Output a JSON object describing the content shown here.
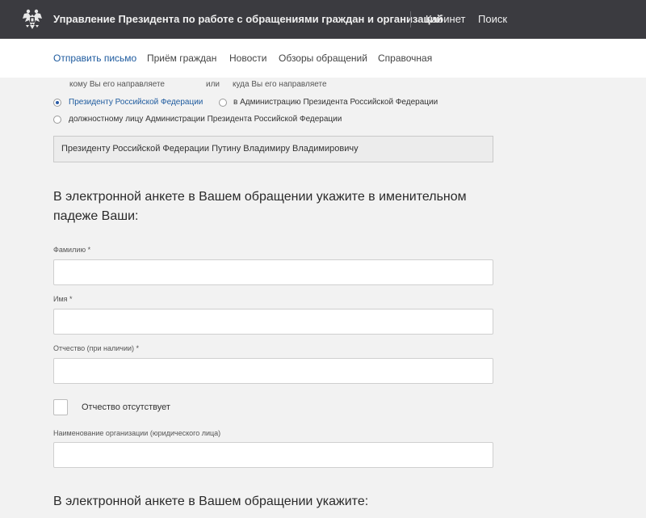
{
  "header": {
    "agency_title": "Управление Президента по работе с обращениями граждан и организаций",
    "links": {
      "cabinet": "Кабинет",
      "search": "Поиск"
    },
    "emblem_icon": "double-headed-eagle-icon",
    "background_color": "#3b3b40"
  },
  "nav": {
    "items": [
      "Отправить письмо",
      "Приём граждан",
      "Новости",
      "Обзоры обращений",
      "Справочная"
    ],
    "active_index": 0,
    "active_color": "#1d5a9e"
  },
  "recipient": {
    "whom_hint": "кому Вы его направляете",
    "or_word": "или",
    "where_hint": "куда Вы его направляете",
    "options": [
      {
        "label": "Президенту Российской Федерации",
        "checked": true
      },
      {
        "label": "в Администрацию Президента Российской Федерации",
        "checked": false
      },
      {
        "label": "должностному лицу Администрации Президента Российской Федерации",
        "checked": false
      }
    ],
    "selected_text": "Президенту Российской Федерации Путину Владимиру Владимировичу"
  },
  "form": {
    "heading1": "В электронной анкете в Вашем обращении укажите в именительном падеже Ваши:",
    "surname": {
      "label": "Фамилию *",
      "value": ""
    },
    "name": {
      "label": "Имя *",
      "value": ""
    },
    "patronymic": {
      "label": "Отчество (при наличии) *",
      "value": ""
    },
    "no_patronymic": {
      "label": "Отчество отсутствует",
      "checked": false
    },
    "organization": {
      "label": "Наименование организации (юридического лица)",
      "value": ""
    },
    "heading2": "В электронной анкете в Вашем обращении укажите:"
  }
}
